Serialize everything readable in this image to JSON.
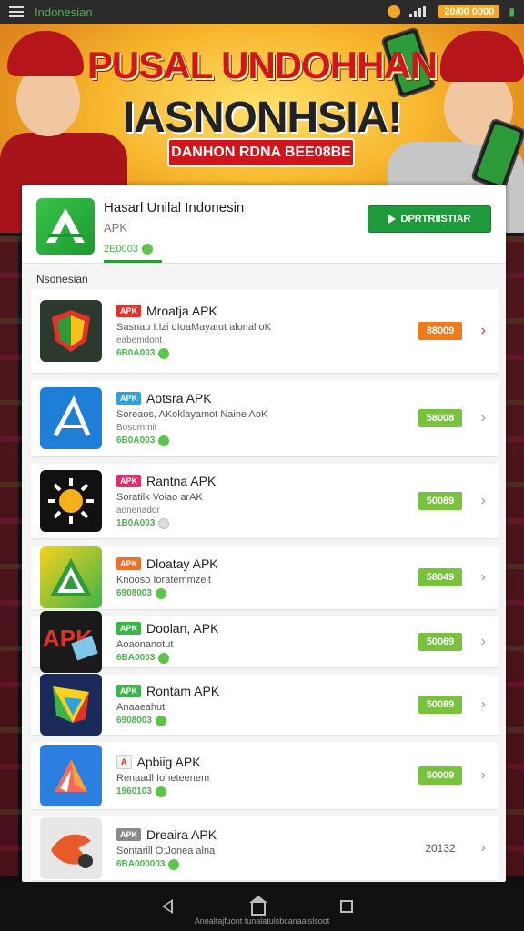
{
  "status_bar": {
    "title": "Indonesian",
    "badge": "20/00 0000"
  },
  "banner": {
    "title_line1": "PUSAL UNDOHHAN",
    "title_line2": "IASNONHSIA!",
    "cta_label": "DANHON RDNA BEE08BE"
  },
  "header": {
    "title": "Hasarl Unilal Indonesin",
    "subtitle": "APK",
    "stat": "2E0003",
    "download_label": "DPRTRIISTIAR"
  },
  "section_label": "Nsonesian",
  "apps": [
    {
      "tag": "APK",
      "tag_color": "#e0312b",
      "name": "Mroatja APK",
      "desc": "Sasnau I:Izi oIoaMayatut alonal oK",
      "sub": "eabemdont",
      "count": "6B0A003",
      "version": "88009",
      "badge_color": "#f07a1c",
      "icon": "shield-icon"
    },
    {
      "tag": "APK",
      "tag_color": "#2fa0e0",
      "name": "Aotsra APK",
      "desc": "Soreaos, AKoklayamot Naine AoK",
      "sub": "Bosommit",
      "count": "6B0A003",
      "version": "58008",
      "badge_color": "#78c23e",
      "icon": "arrow-a-icon"
    },
    {
      "tag": "APK",
      "tag_color": "#e0306a",
      "name": "Rantna APK",
      "desc": "Soratilk Voiao arAK",
      "sub": "aonenador",
      "count": "1B0A003",
      "version": "50089",
      "badge_color": "#78c23e",
      "icon": "sun-icon"
    },
    {
      "tag": "APK",
      "tag_color": "#f0702a",
      "name": "Dloatay APK",
      "desc": "Knooso Ioratemmzeit",
      "sub": "",
      "count": "6908003",
      "version": "58049",
      "badge_color": "#78c23e",
      "icon": "triangle-a-icon"
    },
    {
      "tag": "APK",
      "tag_color": "#3cb44a",
      "name": "Doolan, APK",
      "desc": "Aoaonanotut",
      "sub": "",
      "count": "6BA0003",
      "version": "50069",
      "badge_color": "#78c23e",
      "icon": "apk-text-icon"
    },
    {
      "tag": "APK",
      "tag_color": "#3cb44a",
      "name": "Rontam APK",
      "desc": "Anaaeahut",
      "sub": "",
      "count": "6908003",
      "version": "50089",
      "badge_color": "#78c23e",
      "icon": "prism-icon"
    },
    {
      "tag": "A",
      "tag_color": "#f2f2f2",
      "name": "Apbiig APK",
      "desc": "Renaadl Ioneteenem",
      "sub": "",
      "count": "1960103",
      "version": "50009",
      "badge_color": "#78c23e",
      "icon": "paper-plane-icon"
    },
    {
      "tag": "APK",
      "tag_color": "#8a8a8a",
      "name": "Dreaira APK",
      "desc": "Sontarill O:Jonea alna",
      "sub": "",
      "count": "6BA000003",
      "version": "20132",
      "badge_color": "",
      "icon": "bird-icon"
    }
  ],
  "nav": {
    "caption": "Anealtajfuont tunalatulsbcanaalslsoot"
  },
  "colors": {
    "accent_green": "#1f9a3a",
    "banner_red": "#d0161c"
  }
}
